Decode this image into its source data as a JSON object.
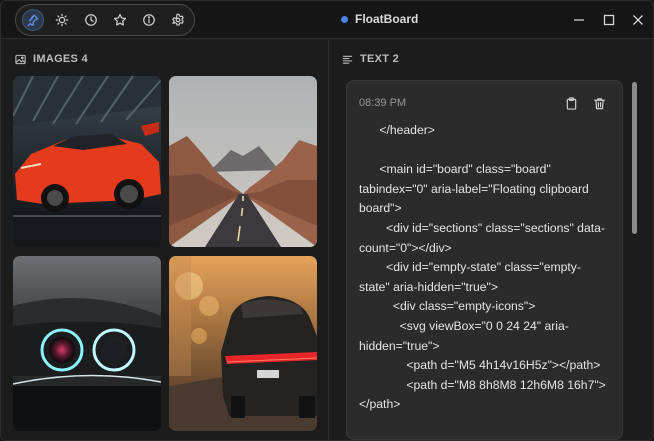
{
  "app": {
    "title": "FloatBoard",
    "accent": "#4a82e8"
  },
  "toolbar": {
    "items": [
      {
        "icon": "pin-icon",
        "active": true
      },
      {
        "icon": "sun-icon"
      },
      {
        "icon": "clock-icon"
      },
      {
        "icon": "star-icon"
      },
      {
        "icon": "info-icon"
      },
      {
        "icon": "gear-icon"
      }
    ]
  },
  "window_controls": [
    "minimize-icon",
    "maximize-icon",
    "close-icon"
  ],
  "images": {
    "header": "IMAGES 4",
    "items": [
      {
        "subject": "red sports car in garage"
      },
      {
        "subject": "desert road through canyon"
      },
      {
        "subject": "car headlights close-up"
      },
      {
        "subject": "car tail lights at sunset"
      }
    ]
  },
  "text": {
    "header": "TEXT 2",
    "card": {
      "time": "08:39 PM",
      "content": "      </header>\n\n      <main id=\"board\" class=\"board\" tabindex=\"0\" aria-label=\"Floating clipboard board\">\n        <div id=\"sections\" class=\"sections\" data-count=\"0\"></div>\n        <div id=\"empty-state\" class=\"empty-state\" aria-hidden=\"true\">\n          <div class=\"empty-icons\">\n            <svg viewBox=\"0 0 24 24\" aria-hidden=\"true\">\n              <path d=\"M5 4h14v16H5z\"></path>\n              <path d=\"M8 8h8M8 12h6M8 16h7\"></path>"
    }
  }
}
